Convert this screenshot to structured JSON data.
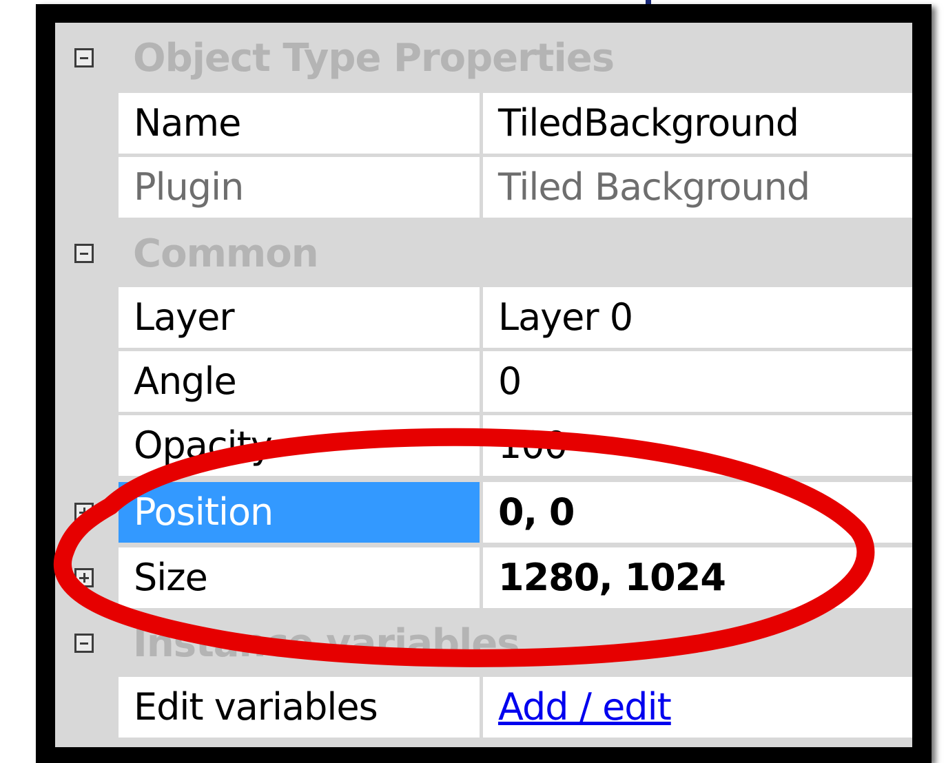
{
  "properties_panel": {
    "categories": [
      {
        "label": "Object Type Properties",
        "rows": [
          {
            "name": "Name",
            "value": "TiledBackground"
          },
          {
            "name": "Plugin",
            "value": "Tiled Background"
          }
        ]
      },
      {
        "label": "Common",
        "rows": [
          {
            "name": "Layer",
            "value": "Layer 0"
          },
          {
            "name": "Angle",
            "value": "0"
          },
          {
            "name": "Opacity",
            "value": "100"
          },
          {
            "name": "Position",
            "value": "0, 0"
          },
          {
            "name": "Size",
            "value": "1280, 1024"
          }
        ]
      },
      {
        "label": "Instance variables",
        "rows": [
          {
            "name": "Edit variables",
            "value": "Add / edit"
          }
        ]
      }
    ],
    "selected_row": "Position"
  },
  "annotation": {
    "shape": "ellipse",
    "color": "#e60000"
  },
  "colors": {
    "selection": "#3399ff",
    "link": "#0000ee",
    "category_text": "#b4b4b4"
  }
}
